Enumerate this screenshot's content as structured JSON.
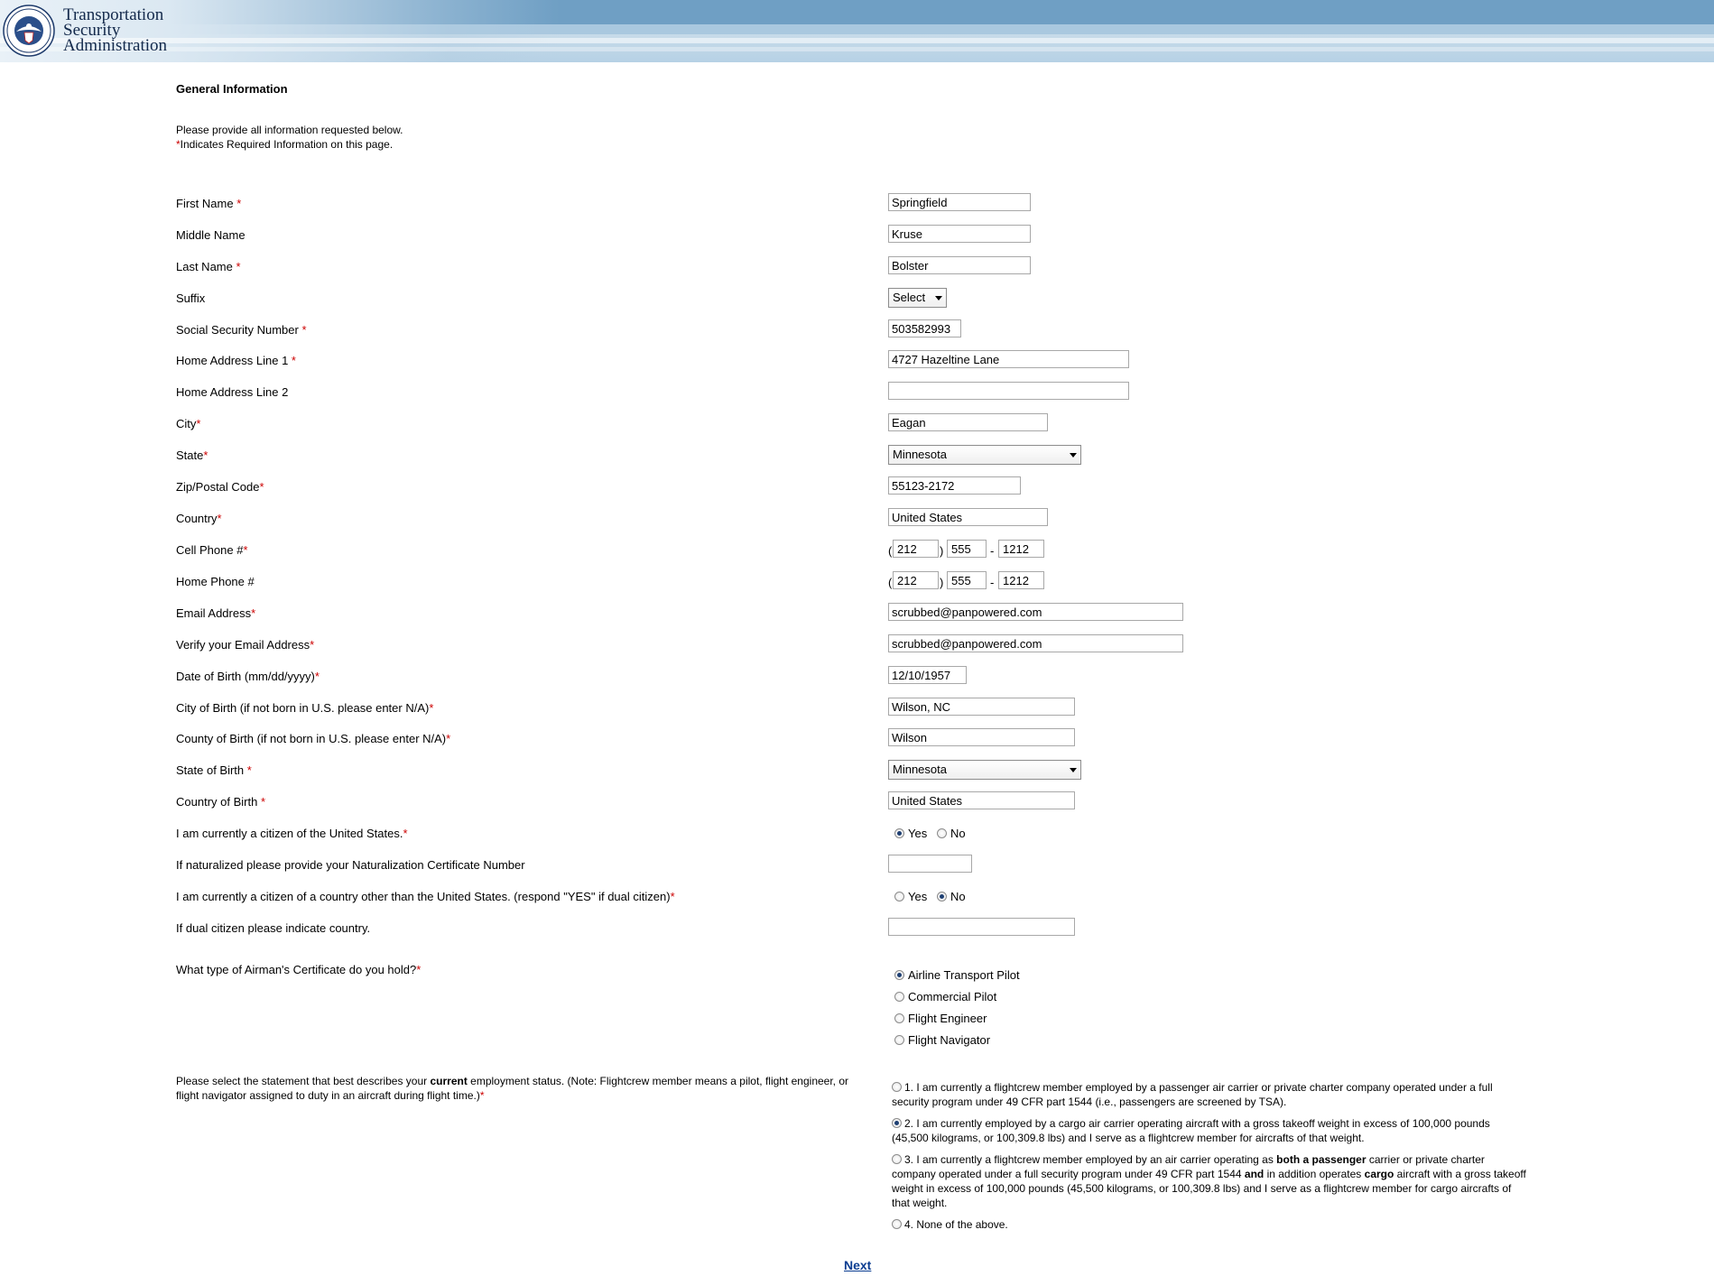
{
  "header": {
    "agency_line1": "Transportation",
    "agency_line2": "Security",
    "agency_line3": "Administration",
    "seal_icon": "dhs-seal-icon"
  },
  "form": {
    "heading": "General Information",
    "intro": "Please provide all information requested below.",
    "required_note_star": "*",
    "required_note": "Indicates Required Information on this page.",
    "fields": {
      "first_name": {
        "label": "First Name",
        "value": "Springfield",
        "req": "*"
      },
      "middle_name": {
        "label": "Middle Name",
        "value": "Kruse"
      },
      "last_name": {
        "label": "Last Name",
        "value": "Bolster",
        "req": "*"
      },
      "suffix": {
        "label": "Suffix",
        "value": "Select"
      },
      "ssn": {
        "label": "Social Security Number",
        "value": "503582993",
        "req": "*"
      },
      "address1": {
        "label": "Home Address Line 1",
        "value": "4727  Hazeltine Lane",
        "req": "*"
      },
      "address2": {
        "label": "Home Address Line 2",
        "value": ""
      },
      "city": {
        "label": "City",
        "value": "Eagan",
        "req": "*"
      },
      "state": {
        "label": "State",
        "value": "Minnesota",
        "req": "*"
      },
      "zip": {
        "label": "Zip/Postal Code",
        "value": "55123-2172",
        "req": "*"
      },
      "country": {
        "label": "Country",
        "value": "United States",
        "req": "*"
      },
      "cell_phone": {
        "label": "Cell Phone #",
        "req": "*",
        "area": "212",
        "prefix": "555",
        "line": "1212"
      },
      "home_phone": {
        "label": "Home Phone #",
        "area": "212",
        "prefix": "555",
        "line": "1212"
      },
      "email": {
        "label": "Email Address",
        "value": "scrubbed@panpowered.com",
        "req": "*"
      },
      "email_verify": {
        "label": "Verify your Email Address",
        "value": "scrubbed@panpowered.com",
        "req": "*"
      },
      "dob": {
        "label": "Date of Birth (mm/dd/yyyy)",
        "value": "12/10/1957",
        "req": "*"
      },
      "city_of_birth": {
        "label": "City of Birth (if not born in U.S. please enter N/A)",
        "value": "Wilson, NC",
        "req": "*"
      },
      "county_of_birth": {
        "label": "County of Birth (if not born in U.S. please enter N/A)",
        "value": "Wilson",
        "req": "*"
      },
      "state_of_birth": {
        "label": "State of Birth",
        "value": "Minnesota",
        "req": "*"
      },
      "country_of_birth": {
        "label": "Country of Birth",
        "value": "United States",
        "req": "*"
      },
      "us_citizen": {
        "label": "I am currently a citizen of the United States.",
        "req": "*",
        "yes": "Yes",
        "no": "No",
        "selected": "Yes"
      },
      "naturalization": {
        "label": "If naturalized please provide your Naturalization Certificate Number",
        "value": ""
      },
      "other_citizen": {
        "label": "I am currently a citizen of a country other than the United States. (respond \"YES\" if dual citizen)",
        "req": "*",
        "yes": "Yes",
        "no": "No",
        "selected": "No"
      },
      "dual_country": {
        "label": "If dual citizen please indicate country.",
        "value": ""
      }
    },
    "airman": {
      "label": "What type of Airman's Certificate do you hold?",
      "req": "*",
      "options": [
        "Airline Transport Pilot",
        "Commercial Pilot",
        "Flight Engineer",
        "Flight Navigator"
      ],
      "selected": "Airline Transport Pilot"
    },
    "employment": {
      "label_pre": "Please select the statement that best describes your ",
      "label_bold": "current",
      "label_post": " employment status. (Note: Flightcrew member means a pilot, flight engineer, or flight navigator assigned to duty in an aircraft during flight time.)",
      "req": "*",
      "opt1": "1. I am currently a flightcrew member employed by a passenger air carrier or private charter company operated under a full security program under 49 CFR part 1544 (i.e., passengers are screened by TSA).",
      "opt2": "2. I am currently employed by a cargo air carrier operating aircraft with a gross takeoff weight in excess of 100,000 pounds (45,500 kilograms, or 100,309.8 lbs) and I serve as a flightcrew member for aircrafts of that weight.",
      "opt3_a": "3. I am currently a flightcrew member employed by an air carrier operating as ",
      "opt3_b": "both a passenger",
      "opt3_c": " carrier or private charter company operated under a full security program under 49 CFR part 1544 ",
      "opt3_d": "and",
      "opt3_e": " in addition operates ",
      "opt3_f": "cargo",
      "opt3_g": " aircraft with a gross takeoff weight in excess of 100,000 pounds (45,500 kilograms, or 100,309.8 lbs) and I serve as a flightcrew member for cargo aircrafts of that weight.",
      "opt4": "4. None of the above.",
      "selected": 2
    },
    "next_label": "Next"
  }
}
